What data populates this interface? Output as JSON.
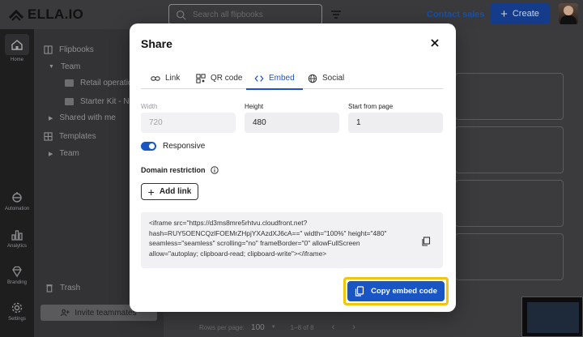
{
  "app": {
    "name": "ELLA.IO"
  },
  "header": {
    "search_placeholder": "Search all flipbooks",
    "contact_label": "Contact sales",
    "create_label": "Create"
  },
  "rail": {
    "home": "Home",
    "automation": "Automation",
    "analytics": "Analytics",
    "branding": "Branding",
    "settings": "Settings"
  },
  "panel": {
    "flipbooks": "Flipbooks",
    "team": "Team",
    "folder1": "Retail operation",
    "folder2": "Starter Kit - New",
    "shared": "Shared with me",
    "templates": "Templates",
    "templates_team": "Team",
    "trash": "Trash",
    "invite": "Invite teammates"
  },
  "pagination": {
    "rows_label": "Rows per page:",
    "rows_value": "100",
    "range": "1–8 of 8"
  },
  "modal": {
    "title": "Share",
    "tabs": [
      {
        "label": "Link"
      },
      {
        "label": "QR code"
      },
      {
        "label": "Embed"
      },
      {
        "label": "Social"
      }
    ],
    "active_tab": "Embed",
    "width_label": "Width",
    "width_value": "720",
    "height_label": "Height",
    "height_value": "480",
    "start_label": "Start from page",
    "start_value": "1",
    "responsive_label": "Responsive",
    "responsive_on": true,
    "restriction_label": "Domain restriction",
    "add_link_label": "Add link",
    "code_lines": [
      "<iframe src=\"https://d3ms8mre5rhtvu.cloudfront.net?",
      "hash=RUY5OENCQzlFOEMrZHpjYXAzdXJ6cA==\" width=\"100%\" height=\"480\"",
      "seamless=\"seamless\" scrolling=\"no\" frameBorder=\"0\" allowFullScreen",
      "allow=\"autoplay; clipboard-read; clipboard-write\"></iframe>"
    ],
    "copy_button_label": "Copy embed code"
  },
  "colors": {
    "accent": "#1a55c4",
    "highlight": "#f1c40f"
  }
}
